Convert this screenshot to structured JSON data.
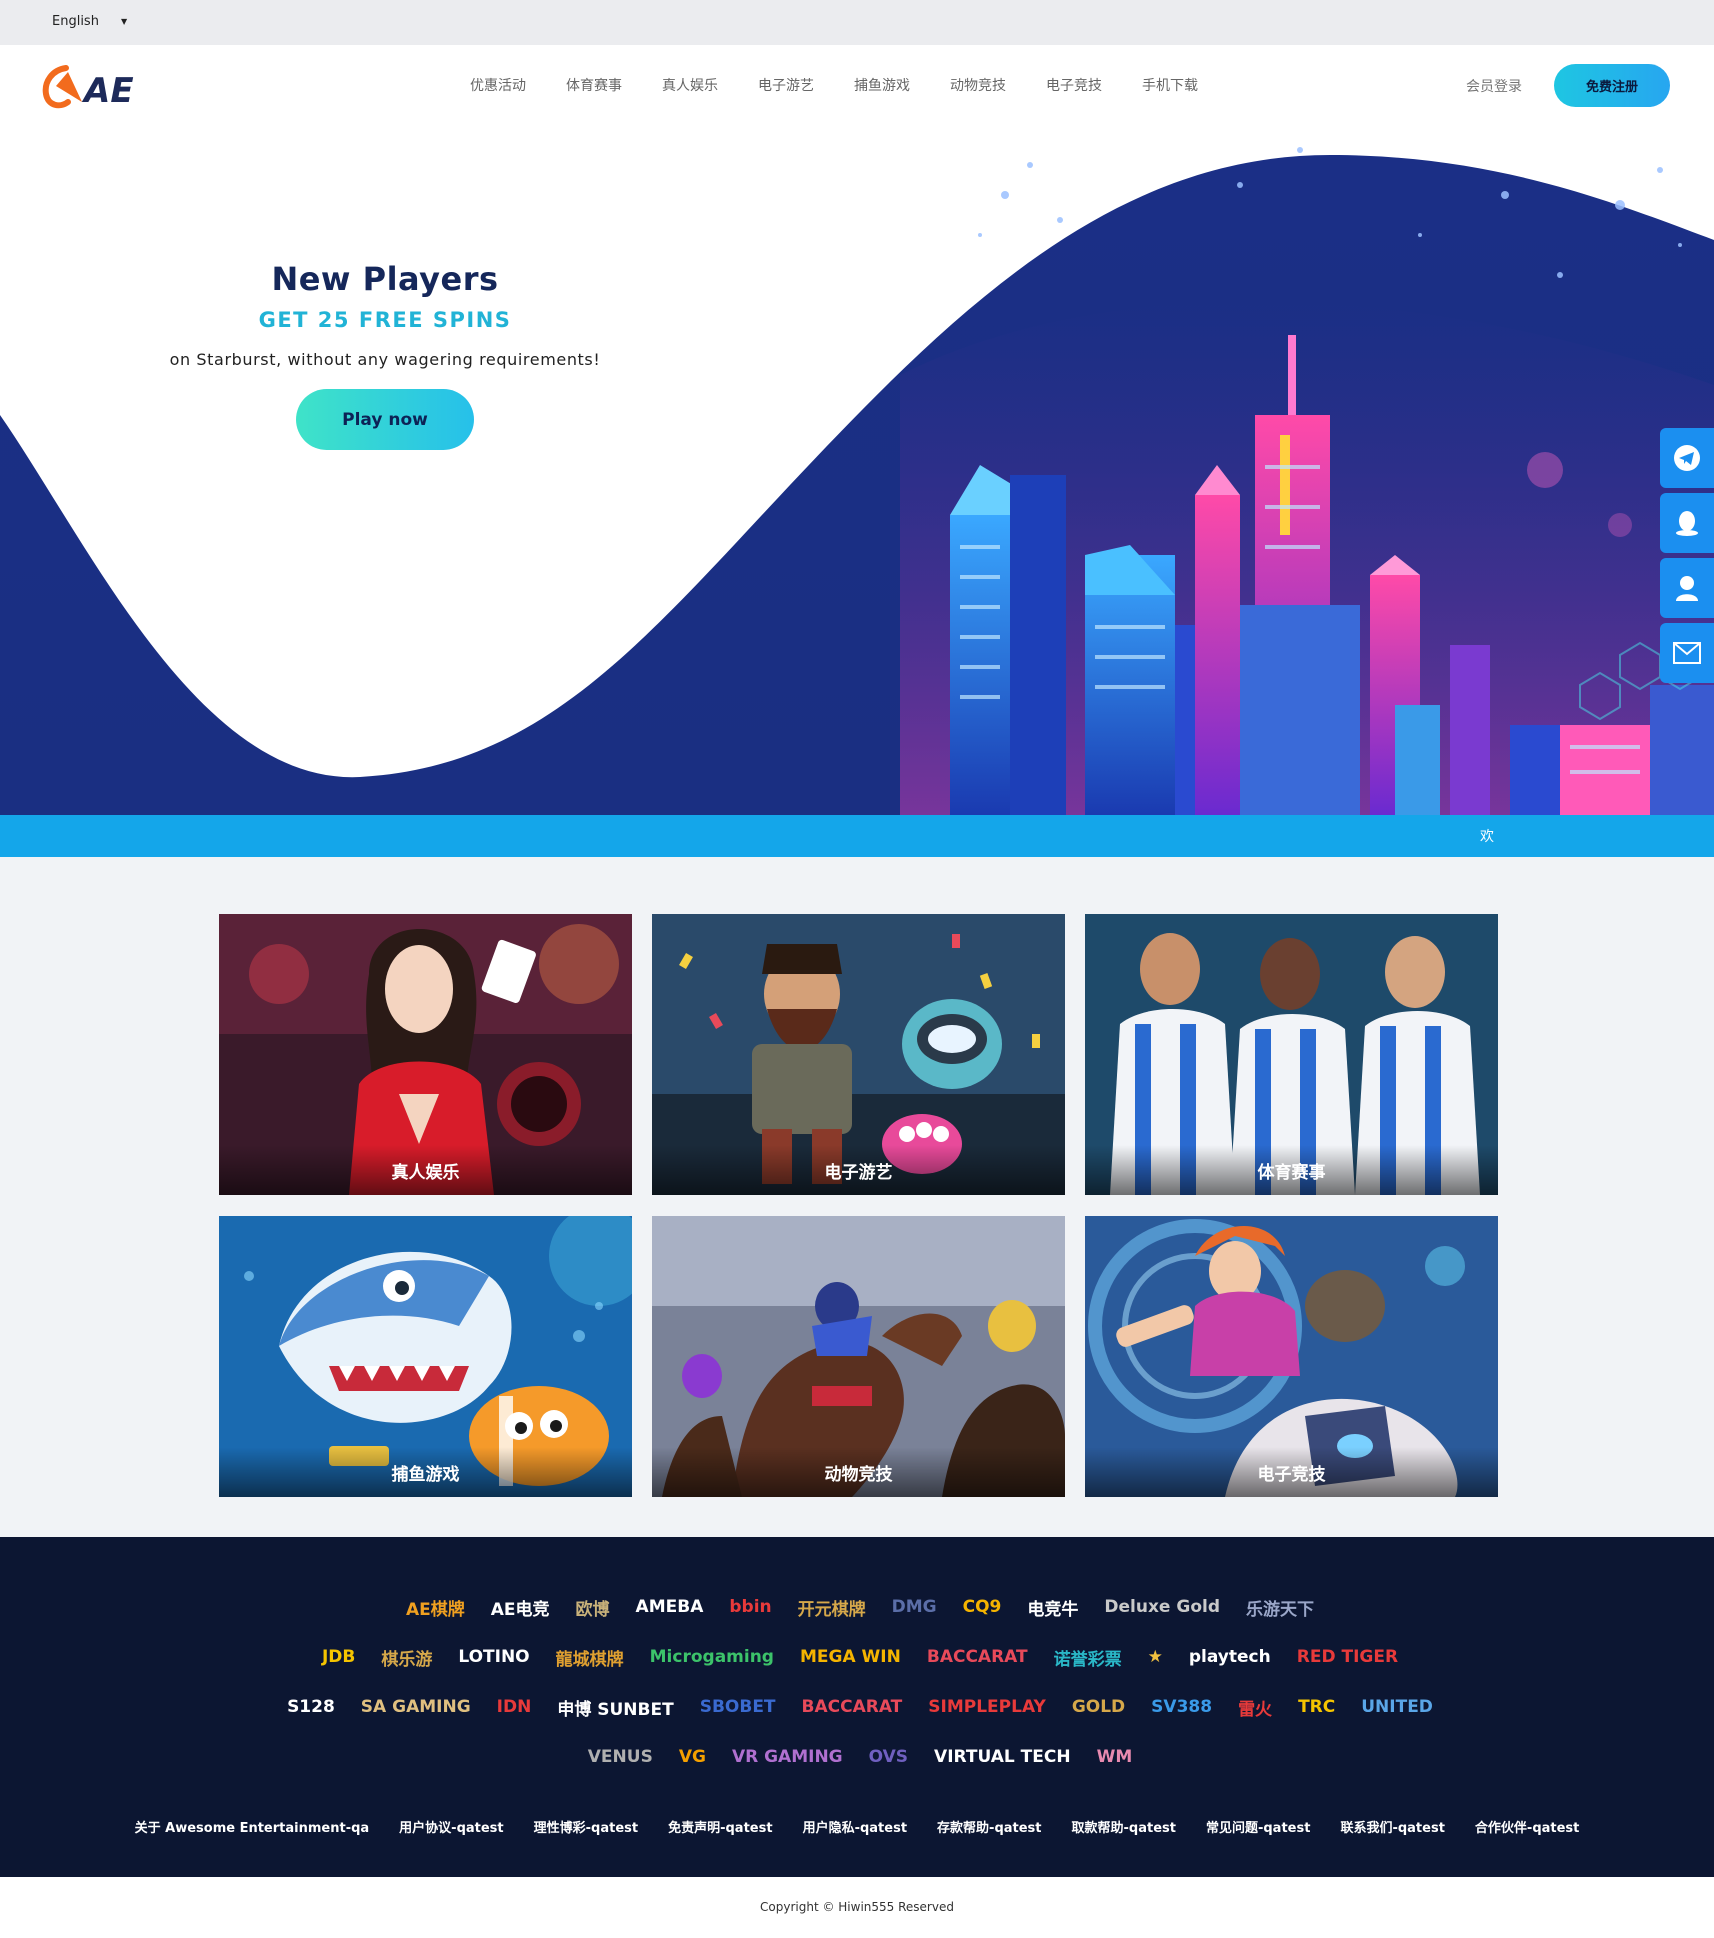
{
  "language": {
    "selected": "English"
  },
  "header": {
    "logo_text": "AE",
    "nav": [
      "优惠活动",
      "体育赛事",
      "真人娱乐",
      "电子游艺",
      "捕鱼游戏",
      "动物竞技",
      "电子竞技",
      "手机下载"
    ],
    "login_label": "会员登录",
    "register_label": "免费注册"
  },
  "hero": {
    "title": "New Players",
    "subtitle": "GET 25 FREE SPINS",
    "description": "on Starburst, without any wagering requirements!",
    "cta_label": "Play now"
  },
  "side_buttons": [
    "telegram-icon",
    "qq-icon",
    "support-icon",
    "mail-icon"
  ],
  "ticker": {
    "text": "欢"
  },
  "games": [
    {
      "label": "真人娱乐",
      "theme": "live-casino"
    },
    {
      "label": "电子游艺",
      "theme": "slots"
    },
    {
      "label": "体育赛事",
      "theme": "sports"
    },
    {
      "label": "捕鱼游戏",
      "theme": "fishing"
    },
    {
      "label": "动物竞技",
      "theme": "horse-racing"
    },
    {
      "label": "电子竞技",
      "theme": "esports"
    }
  ],
  "footer": {
    "brand_rows": [
      [
        {
          "name": "AE棋牌",
          "color": "#f0a020"
        },
        {
          "name": "AE电竞",
          "color": "#ffffff"
        },
        {
          "name": "欧博",
          "color": "#c9b27a"
        },
        {
          "name": "AMEBA",
          "color": "#ffffff"
        },
        {
          "name": "bbin",
          "color": "#e83a3a"
        },
        {
          "name": "开元棋牌",
          "color": "#d6a84a"
        },
        {
          "name": "DMG",
          "color": "#5b6ea8"
        },
        {
          "name": "CQ9",
          "color": "#f5b400"
        },
        {
          "name": "电竞牛",
          "color": "#ffffff"
        },
        {
          "name": "Deluxe Gold",
          "color": "#c9c9c9"
        },
        {
          "name": "乐游天下",
          "color": "#9aa6c8"
        }
      ],
      [
        {
          "name": "JDB",
          "color": "#f5c400"
        },
        {
          "name": "棋乐游",
          "color": "#d6a84a"
        },
        {
          "name": "LOTINO",
          "color": "#ffffff"
        },
        {
          "name": "龍城棋牌",
          "color": "#e0a030"
        },
        {
          "name": "Microgaming",
          "color": "#3cc36a"
        },
        {
          "name": "MEGA WIN",
          "color": "#f5b400"
        },
        {
          "name": "BACCARAT",
          "color": "#e84a5a"
        },
        {
          "name": "诺誉彩票",
          "color": "#2ab8c8"
        },
        {
          "name": "★",
          "color": "#f0c040"
        },
        {
          "name": "playtech",
          "color": "#ffffff"
        },
        {
          "name": "RED TIGER",
          "color": "#e83a3a"
        }
      ],
      [
        {
          "name": "S128",
          "color": "#ffffff"
        },
        {
          "name": "SA GAMING",
          "color": "#e0c080"
        },
        {
          "name": "IDN",
          "color": "#e83a3a"
        },
        {
          "name": "申博 SUNBET",
          "color": "#ffffff"
        },
        {
          "name": "SBOBET",
          "color": "#3a6ad0"
        },
        {
          "name": "BACCARAT",
          "color": "#e84a5a"
        },
        {
          "name": "SIMPLEPLAY",
          "color": "#e83a3a"
        },
        {
          "name": "GOLD",
          "color": "#d6a84a"
        },
        {
          "name": "SV388",
          "color": "#3a9ae8"
        },
        {
          "name": "雷火",
          "color": "#e83a3a"
        },
        {
          "name": "TRC",
          "color": "#f5c400"
        },
        {
          "name": "UNITED",
          "color": "#5aa6e8"
        }
      ],
      [
        {
          "name": "VENUS",
          "color": "#b0b0b0"
        },
        {
          "name": "VG",
          "color": "#f5a000"
        },
        {
          "name": "VR GAMING",
          "color": "#b070d0"
        },
        {
          "name": "OVS",
          "color": "#7060c0"
        },
        {
          "name": "VIRTUAL TECH",
          "color": "#ffffff"
        },
        {
          "name": "WM",
          "color": "#e88ab0"
        }
      ]
    ],
    "links": [
      "关于 Awesome Entertainment-qa",
      "用户协议-qatest",
      "理性博彩-qatest",
      "免责声明-qatest",
      "用户隐私-qatest",
      "存款帮助-qatest",
      "取款帮助-qatest",
      "常见问题-qatest",
      "联系我们-qatest",
      "合作伙伴-qatest"
    ],
    "copyright": "Copyright © Hiwin555 Reserved"
  }
}
